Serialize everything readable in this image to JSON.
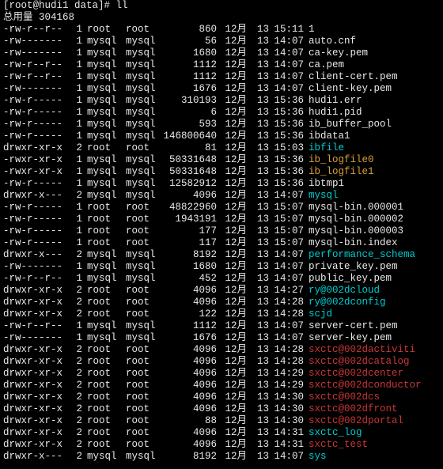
{
  "prompt": "[root@hudi1 data]# ll",
  "total_label": "总用量 304168",
  "rows": [
    {
      "perm": "-rw-r--r--",
      "l": "1",
      "o": "root",
      "g": "root",
      "s": "860",
      "m": "12月",
      "d": "13",
      "t": "15:11",
      "n": "1",
      "c": "c-white"
    },
    {
      "perm": "-rw-------",
      "l": "1",
      "o": "mysql",
      "g": "mysql",
      "s": "56",
      "m": "12月",
      "d": "13",
      "t": "14:07",
      "n": "auto.cnf",
      "c": "c-white"
    },
    {
      "perm": "-rw-------",
      "l": "1",
      "o": "mysql",
      "g": "mysql",
      "s": "1680",
      "m": "12月",
      "d": "13",
      "t": "14:07",
      "n": "ca-key.pem",
      "c": "c-white"
    },
    {
      "perm": "-rw-r--r--",
      "l": "1",
      "o": "mysql",
      "g": "mysql",
      "s": "1112",
      "m": "12月",
      "d": "13",
      "t": "14:07",
      "n": "ca.pem",
      "c": "c-white"
    },
    {
      "perm": "-rw-r--r--",
      "l": "1",
      "o": "mysql",
      "g": "mysql",
      "s": "1112",
      "m": "12月",
      "d": "13",
      "t": "14:07",
      "n": "client-cert.pem",
      "c": "c-white"
    },
    {
      "perm": "-rw-------",
      "l": "1",
      "o": "mysql",
      "g": "mysql",
      "s": "1676",
      "m": "12月",
      "d": "13",
      "t": "14:07",
      "n": "client-key.pem",
      "c": "c-white"
    },
    {
      "perm": "-rw-r-----",
      "l": "1",
      "o": "mysql",
      "g": "mysql",
      "s": "310193",
      "m": "12月",
      "d": "13",
      "t": "15:36",
      "n": "hudi1.err",
      "c": "c-white"
    },
    {
      "perm": "-rw-r-----",
      "l": "1",
      "o": "mysql",
      "g": "mysql",
      "s": "6",
      "m": "12月",
      "d": "13",
      "t": "15:36",
      "n": "hudi1.pid",
      "c": "c-white"
    },
    {
      "perm": "-rw-r-----",
      "l": "1",
      "o": "mysql",
      "g": "mysql",
      "s": "593",
      "m": "12月",
      "d": "13",
      "t": "15:36",
      "n": "ib_buffer_pool",
      "c": "c-white"
    },
    {
      "perm": "-rw-r-----",
      "l": "1",
      "o": "mysql",
      "g": "mysql",
      "s": "146800640",
      "m": "12月",
      "d": "13",
      "t": "15:36",
      "n": "ibdata1",
      "c": "c-white"
    },
    {
      "perm": "drwxr-xr-x",
      "l": "2",
      "o": "root",
      "g": "root",
      "s": "81",
      "m": "12月",
      "d": "13",
      "t": "15:03",
      "n": "ibfile",
      "c": "c-cyan"
    },
    {
      "perm": "-rwxr-xr-x",
      "l": "1",
      "o": "mysql",
      "g": "mysql",
      "s": "50331648",
      "m": "12月",
      "d": "13",
      "t": "15:36",
      "n": "ib_logfile0",
      "c": "c-orange"
    },
    {
      "perm": "-rwxr-xr-x",
      "l": "1",
      "o": "mysql",
      "g": "mysql",
      "s": "50331648",
      "m": "12月",
      "d": "13",
      "t": "15:36",
      "n": "ib_logfile1",
      "c": "c-orange"
    },
    {
      "perm": "-rw-r-----",
      "l": "1",
      "o": "mysql",
      "g": "mysql",
      "s": "12582912",
      "m": "12月",
      "d": "13",
      "t": "15:36",
      "n": "ibtmp1",
      "c": "c-white"
    },
    {
      "perm": "drwxr-x---",
      "l": "2",
      "o": "mysql",
      "g": "mysql",
      "s": "4096",
      "m": "12月",
      "d": "13",
      "t": "14:07",
      "n": "mysql",
      "c": "c-cyan"
    },
    {
      "perm": "-rw-r-----",
      "l": "1",
      "o": "root",
      "g": "root",
      "s": "48822960",
      "m": "12月",
      "d": "13",
      "t": "15:07",
      "n": "mysql-bin.000001",
      "c": "c-white"
    },
    {
      "perm": "-rw-r-----",
      "l": "1",
      "o": "root",
      "g": "root",
      "s": "1943191",
      "m": "12月",
      "d": "13",
      "t": "15:07",
      "n": "mysql-bin.000002",
      "c": "c-white"
    },
    {
      "perm": "-rw-r-----",
      "l": "1",
      "o": "root",
      "g": "root",
      "s": "177",
      "m": "12月",
      "d": "13",
      "t": "15:07",
      "n": "mysql-bin.000003",
      "c": "c-white"
    },
    {
      "perm": "-rw-r-----",
      "l": "1",
      "o": "root",
      "g": "root",
      "s": "117",
      "m": "12月",
      "d": "13",
      "t": "15:07",
      "n": "mysql-bin.index",
      "c": "c-white"
    },
    {
      "perm": "drwxr-x---",
      "l": "2",
      "o": "mysql",
      "g": "mysql",
      "s": "8192",
      "m": "12月",
      "d": "13",
      "t": "14:07",
      "n": "performance_schema",
      "c": "c-cyan"
    },
    {
      "perm": "-rw-------",
      "l": "1",
      "o": "mysql",
      "g": "mysql",
      "s": "1680",
      "m": "12月",
      "d": "13",
      "t": "14:07",
      "n": "private_key.pem",
      "c": "c-white"
    },
    {
      "perm": "-rw-r--r--",
      "l": "1",
      "o": "mysql",
      "g": "mysql",
      "s": "452",
      "m": "12月",
      "d": "13",
      "t": "14:07",
      "n": "public_key.pem",
      "c": "c-white"
    },
    {
      "perm": "drwxr-xr-x",
      "l": "2",
      "o": "root",
      "g": "root",
      "s": "4096",
      "m": "12月",
      "d": "13",
      "t": "14:27",
      "n": "ry@002dcloud",
      "c": "c-cyan"
    },
    {
      "perm": "drwxr-xr-x",
      "l": "2",
      "o": "root",
      "g": "root",
      "s": "4096",
      "m": "12月",
      "d": "13",
      "t": "14:28",
      "n": "ry@002dconfig",
      "c": "c-cyan"
    },
    {
      "perm": "drwxr-xr-x",
      "l": "2",
      "o": "root",
      "g": "root",
      "s": "122",
      "m": "12月",
      "d": "13",
      "t": "14:28",
      "n": "scjd",
      "c": "c-cyan"
    },
    {
      "perm": "-rw-r--r--",
      "l": "1",
      "o": "mysql",
      "g": "mysql",
      "s": "1112",
      "m": "12月",
      "d": "13",
      "t": "14:07",
      "n": "server-cert.pem",
      "c": "c-white"
    },
    {
      "perm": "-rw-------",
      "l": "1",
      "o": "mysql",
      "g": "mysql",
      "s": "1676",
      "m": "12月",
      "d": "13",
      "t": "14:07",
      "n": "server-key.pem",
      "c": "c-white"
    },
    {
      "perm": "drwxr-xr-x",
      "l": "2",
      "o": "root",
      "g": "root",
      "s": "4096",
      "m": "12月",
      "d": "13",
      "t": "14:28",
      "n": "sxctc@002dactiviti",
      "c": "c-red"
    },
    {
      "perm": "drwxr-xr-x",
      "l": "2",
      "o": "root",
      "g": "root",
      "s": "4096",
      "m": "12月",
      "d": "13",
      "t": "14:28",
      "n": "sxctc@002dcatalog",
      "c": "c-red"
    },
    {
      "perm": "drwxr-xr-x",
      "l": "2",
      "o": "root",
      "g": "root",
      "s": "4096",
      "m": "12月",
      "d": "13",
      "t": "14:29",
      "n": "sxctc@002dcenter",
      "c": "c-red"
    },
    {
      "perm": "drwxr-xr-x",
      "l": "2",
      "o": "root",
      "g": "root",
      "s": "4096",
      "m": "12月",
      "d": "13",
      "t": "14:29",
      "n": "sxctc@002dconductor",
      "c": "c-red"
    },
    {
      "perm": "drwxr-xr-x",
      "l": "2",
      "o": "root",
      "g": "root",
      "s": "4096",
      "m": "12月",
      "d": "13",
      "t": "14:30",
      "n": "sxctc@002dcs",
      "c": "c-red"
    },
    {
      "perm": "drwxr-xr-x",
      "l": "2",
      "o": "root",
      "g": "root",
      "s": "4096",
      "m": "12月",
      "d": "13",
      "t": "14:30",
      "n": "sxctc@002dfront",
      "c": "c-red"
    },
    {
      "perm": "drwxr-xr-x",
      "l": "2",
      "o": "root",
      "g": "root",
      "s": "88",
      "m": "12月",
      "d": "13",
      "t": "14:30",
      "n": "sxctc@002dportal",
      "c": "c-red"
    },
    {
      "perm": "drwxr-xr-x",
      "l": "2",
      "o": "root",
      "g": "root",
      "s": "4096",
      "m": "12月",
      "d": "13",
      "t": "14:31",
      "n": "sxctc_log",
      "c": "c-cyan"
    },
    {
      "perm": "drwxr-xr-x",
      "l": "2",
      "o": "root",
      "g": "root",
      "s": "4096",
      "m": "12月",
      "d": "13",
      "t": "14:31",
      "n": "sxctc_test",
      "c": "c-red"
    },
    {
      "perm": "drwxr-x---",
      "l": "2",
      "o": "mysql",
      "g": "mysql",
      "s": "8192",
      "m": "12月",
      "d": "13",
      "t": "14:07",
      "n": "sys",
      "c": "c-cyan"
    }
  ]
}
